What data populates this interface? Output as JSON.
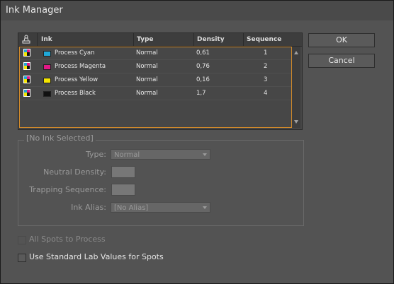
{
  "window": {
    "title": "Ink Manager"
  },
  "table": {
    "headers": {
      "ink": "Ink",
      "type": "Type",
      "density": "Density",
      "sequence": "Sequence"
    },
    "rows": [
      {
        "ink": "Process Cyan",
        "swatch": "#1fa8d8",
        "type": "Normal",
        "density": "0,61",
        "sequence": "1"
      },
      {
        "ink": "Process Magenta",
        "swatch": "#e21886",
        "type": "Normal",
        "density": "0,76",
        "sequence": "2"
      },
      {
        "ink": "Process Yellow",
        "swatch": "#f5e500",
        "type": "Normal",
        "density": "0,16",
        "sequence": "3"
      },
      {
        "ink": "Process Black",
        "swatch": "#111111",
        "type": "Normal",
        "density": "1,7",
        "sequence": "4"
      }
    ]
  },
  "buttons": {
    "ok": "OK",
    "cancel": "Cancel"
  },
  "details": {
    "group_title": "[No Ink Selected]",
    "type_label": "Type:",
    "type_value": "Normal",
    "neutral_density_label": "Neutral Density:",
    "trapping_sequence_label": "Trapping Sequence:",
    "ink_alias_label": "Ink Alias:",
    "ink_alias_value": "[No Alias]"
  },
  "options": {
    "all_spots_label": "All Spots to Process",
    "standard_lab_label": "Use Standard Lab Values for Spots"
  },
  "colors": {
    "accent_selection": "#d18a2a"
  }
}
